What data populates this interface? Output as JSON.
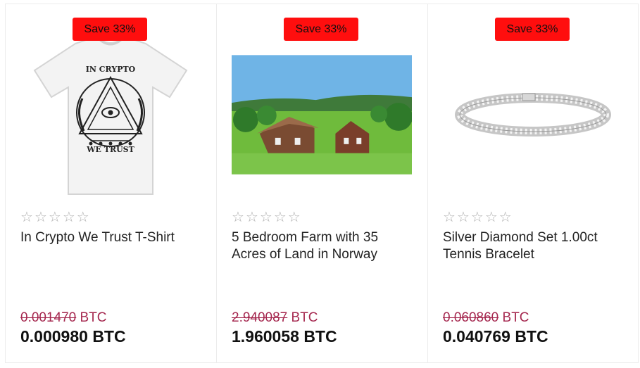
{
  "products": [
    {
      "badge": "Save 33%",
      "image_icon": "crypto-tshirt-image",
      "shirt_text_top": "IN CRYPTO",
      "shirt_text_bottom": "WE TRUST",
      "rating_stars": 0,
      "title": "In Crypto We Trust T-Shirt",
      "old_price": "0.001470",
      "currency": "BTC",
      "price": "0.000980 BTC"
    },
    {
      "badge": "Save 33%",
      "image_icon": "norway-farm-image",
      "rating_stars": 0,
      "title": "5 Bedroom Farm with 35 Acres of Land in Norway",
      "old_price": "2.940087",
      "currency": "BTC",
      "price": "1.960058 BTC"
    },
    {
      "badge": "Save 33%",
      "image_icon": "tennis-bracelet-image",
      "rating_stars": 0,
      "title": "Silver Diamond Set 1.00ct Tennis Bracelet",
      "old_price": "0.060860",
      "currency": "BTC",
      "price": "0.040769 BTC"
    }
  ],
  "colors": {
    "badge": "#ff0e0e",
    "old_price": "#a5284f",
    "star_empty": "#b0b0b0",
    "border": "#ececec"
  }
}
